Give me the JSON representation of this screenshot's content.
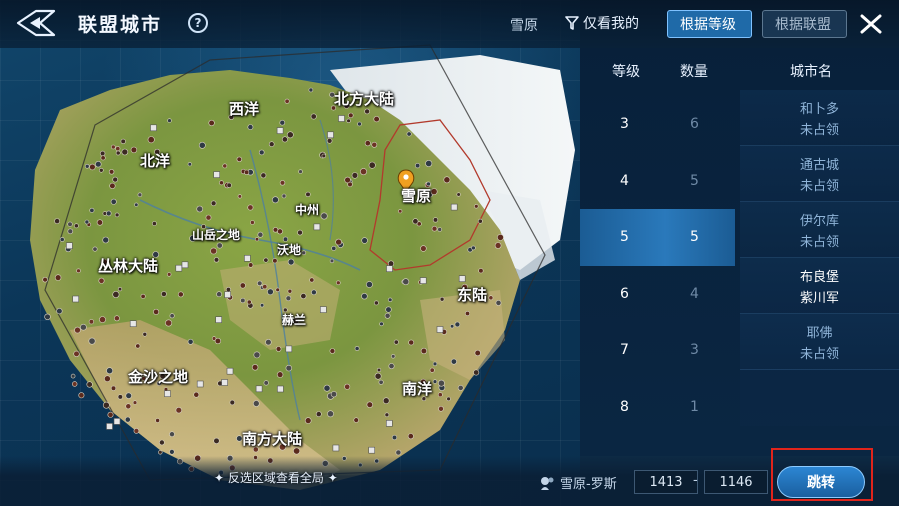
{
  "header": {
    "title": "联盟城市",
    "current_location": "雪原",
    "filter_mine_label": "仅看我的",
    "tab_by_level": "根据等级",
    "tab_by_alliance": "根据联盟"
  },
  "map": {
    "regions": {
      "west_sea": "西洋",
      "north_land": "北方大陆",
      "north_sea": "北洋",
      "snowfield": "雪原",
      "central": "中州",
      "mountain": "山岳之地",
      "plains": "沃地",
      "jungle": "丛林大陆",
      "east_land": "东陆",
      "helan": "赫兰",
      "golden_sand": "金沙之地",
      "south_sea": "南洋",
      "south_land": "南方大陆"
    },
    "hint": "反选区域查看全局"
  },
  "table": {
    "col_level": "等级",
    "col_count": "数量",
    "col_city": "城市名",
    "levels": [
      {
        "level": "3",
        "count": "6"
      },
      {
        "level": "4",
        "count": "5"
      },
      {
        "level": "5",
        "count": "5"
      },
      {
        "level": "6",
        "count": "4"
      },
      {
        "level": "7",
        "count": "3"
      },
      {
        "level": "8",
        "count": "1"
      }
    ],
    "cities": [
      {
        "name": "和卜多",
        "status": "未占领"
      },
      {
        "name": "通古城",
        "status": "未占领"
      },
      {
        "name": "伊尔库",
        "status": "未占领"
      },
      {
        "name": "布良堡",
        "status": "紫川军"
      },
      {
        "name": "耶佛",
        "status": "未占领"
      }
    ]
  },
  "bottom": {
    "location_name": "雪原-罗斯",
    "coord_x": "1413",
    "coord_sep": "-",
    "coord_y": "1146",
    "jump_label": "跳转"
  },
  "colors": {
    "accent": "#1f6aa8",
    "highlight_border": "#e0241b",
    "land": "#7e9a3c",
    "sand": "#c9b27a"
  }
}
